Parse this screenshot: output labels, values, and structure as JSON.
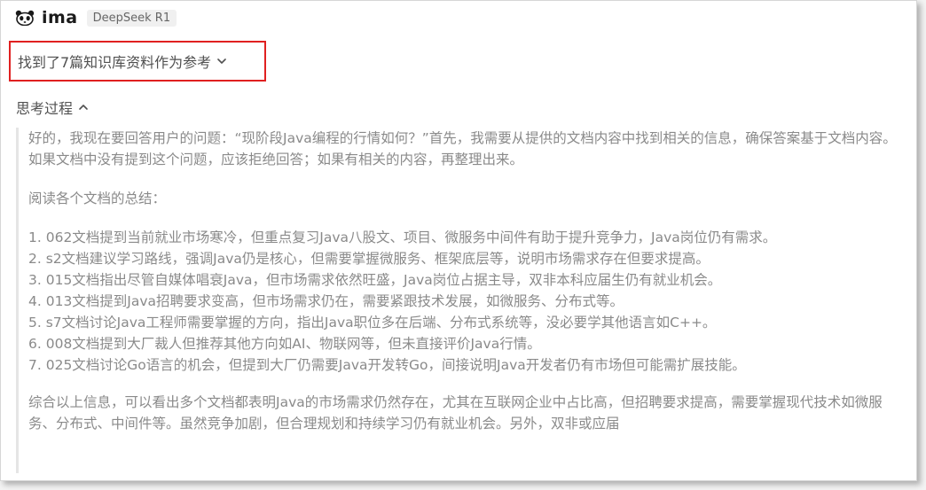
{
  "header": {
    "app_name": "ima",
    "model_badge": "DeepSeek R1",
    "logo_icon": "panda-icon"
  },
  "references": {
    "label": "找到了7篇知识库资料作为参考",
    "icon": "chevron-down-icon"
  },
  "thinking": {
    "label": "思考过程",
    "icon": "chevron-up-icon",
    "paragraphs": {
      "intro": "好的，我现在要回答用户的问题：“现阶段Java编程的行情如何？”首先，我需要从提供的文档内容中找到相关的信息，确保答案基于文档内容。如果文档中没有提到这个问题，应该拒绝回答；如果有相关的内容，再整理出来。",
      "summary_heading": "阅读各个文档的总结：",
      "items": [
        "1. 062文档提到当前就业市场寒冷，但重点复习Java八股文、项目、微服务中间件有助于提升竞争力，Java岗位仍有需求。",
        "2. s2文档建议学习路线，强调Java仍是核心，但需要掌握微服务、框架底层等，说明市场需求存在但要求提高。",
        "3. 015文档指出尽管自媒体唱衰Java，但市场需求依然旺盛，Java岗位占据主导，双非本科应届生仍有就业机会。",
        "4. 013文档提到Java招聘要求变高，但市场需求仍在，需要紧跟技术发展，如微服务、分布式等。",
        "5. s7文档讨论Java工程师需要掌握的方向，指出Java职位多在后端、分布式系统等，没必要学其他语言如C++。",
        "6. 008文档提到大厂裁人但推荐其他方向如AI、物联网等，但未直接评价Java行情。",
        "7. 025文档讨论Go语言的机会，但提到大厂仍需要Java开发转Go，间接说明Java开发者仍有市场但可能需扩展技能。"
      ],
      "conclusion": "综合以上信息，可以看出多个文档都表明Java的市场需求仍然存在，尤其在互联网企业中占比高，但招聘要求提高，需要掌握现代技术如微服务、分布式、中间件等。虽然竞争加剧，但合理规划和持续学习仍有就业机会。另外，双非或应届"
    }
  },
  "colors": {
    "highlight_border": "#e02020",
    "body_text": "#8a8a8a",
    "label_text": "#505050",
    "quote_bar": "#e5e5e5"
  }
}
